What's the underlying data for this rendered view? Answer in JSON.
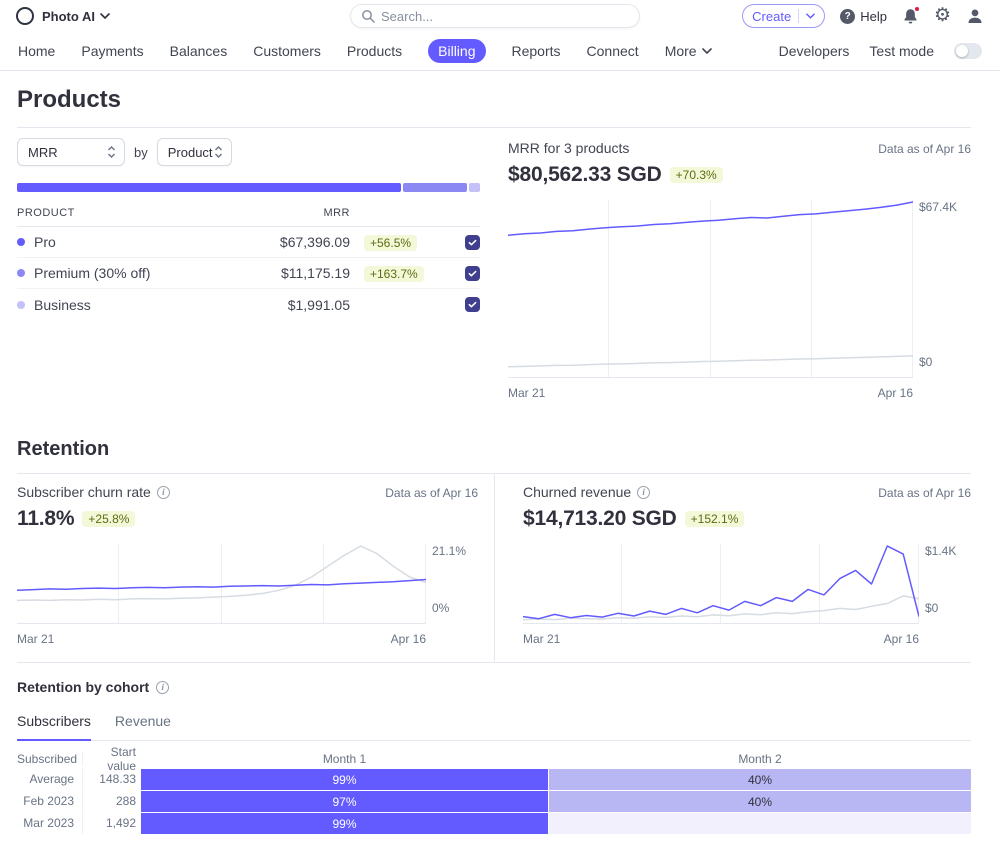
{
  "colors": {
    "accent": "#635bff",
    "hairline": "#e3e8ee",
    "badge_bg": "#f2f8d8",
    "badge_text": "#5f6c12",
    "checkbox": "#3f3e8f",
    "chart_current": "#635bff",
    "chart_previous": "#d7dce2",
    "notification_dot": "#df1b41"
  },
  "header": {
    "app_name": "Photo AI",
    "search_placeholder": "Search...",
    "create_label": "Create",
    "help_label": "Help"
  },
  "nav": {
    "items": [
      "Home",
      "Payments",
      "Balances",
      "Customers",
      "Products",
      "Billing",
      "Reports",
      "Connect",
      "More"
    ],
    "active_item": "Billing",
    "developers_label": "Developers",
    "test_mode_label": "Test mode"
  },
  "page": {
    "title": "Products"
  },
  "mrr_section": {
    "metric_select_value": "MRR",
    "by_label": "by",
    "group_select_value": "Product",
    "table": {
      "col_product": "PRODUCT",
      "col_mrr": "MRR",
      "rows": [
        {
          "name": "Pro",
          "value": "$67,396.09",
          "delta": "+56.5%",
          "color": "#635bff",
          "share_pct": 83.7,
          "checked": true
        },
        {
          "name": "Premium (30% off)",
          "value": "$11,175.19",
          "delta": "+163.7%",
          "color": "#8c88f3",
          "share_pct": 13.9,
          "checked": true
        },
        {
          "name": "Business",
          "value": "$1,991.05",
          "delta": "",
          "color": "#c3c1f7",
          "share_pct": 2.4,
          "checked": true
        }
      ]
    },
    "summary": {
      "title": "MRR for 3 products",
      "data_as_of": "Data as of Apr 16",
      "amount": "$80,562.33 SGD",
      "delta": "+70.3%",
      "y_max_label": "$67.4K",
      "y_min_label": "$0",
      "x_start": "Mar 21",
      "x_end": "Apr 16"
    }
  },
  "retention": {
    "title": "Retention",
    "churn": {
      "title": "Subscriber churn rate",
      "data_as_of": "Data as of Apr 16",
      "value": "11.8%",
      "delta": "+25.8%",
      "y_max_label": "21.1%",
      "y_min_label": "0%",
      "x_start": "Mar 21",
      "x_end": "Apr 16"
    },
    "churned_revenue": {
      "title": "Churned revenue",
      "data_as_of": "Data as of Apr 16",
      "value": "$14,713.20 SGD",
      "delta": "+152.1%",
      "y_max_label": "$1.4K",
      "y_min_label": "$0",
      "x_start": "Mar 21",
      "x_end": "Apr 16"
    },
    "cohort": {
      "title": "Retention by cohort",
      "tabs": [
        "Subscribers",
        "Revenue"
      ],
      "active_tab": "Subscribers",
      "col_subscribed": "Subscribed",
      "col_start_value": "Start value",
      "col_month1": "Month 1",
      "col_month2": "Month 2",
      "rows": [
        {
          "label": "Average",
          "start": "148.33",
          "m1": {
            "text": "99%",
            "bg": "#635bff",
            "fg": "#ffffff"
          },
          "m2": {
            "text": "40%",
            "bg": "#b9b6f4",
            "fg": "#30313d"
          }
        },
        {
          "label": "Feb 2023",
          "start": "288",
          "m1": {
            "text": "97%",
            "bg": "#635bff",
            "fg": "#ffffff"
          },
          "m2": {
            "text": "40%",
            "bg": "#b9b6f4",
            "fg": "#30313d"
          }
        },
        {
          "label": "Mar 2023",
          "start": "1,492",
          "m1": {
            "text": "99%",
            "bg": "#635bff",
            "fg": "#ffffff"
          },
          "m2": {
            "text": "",
            "bg": "#f1f0fc",
            "fg": "#30313d"
          }
        }
      ]
    }
  },
  "chart_data": [
    {
      "id": "mrr_trend",
      "type": "line",
      "title": "MRR for 3 products",
      "x_range": [
        "Mar 21",
        "Apr 16"
      ],
      "y_range": [
        0,
        67400
      ],
      "grid": "vertical",
      "series": [
        {
          "name": "current",
          "color": "#635bff",
          "values": [
            54500,
            55100,
            55400,
            56000,
            56300,
            56900,
            57400,
            57800,
            58100,
            58700,
            59000,
            59500,
            60000,
            60300,
            60900,
            61400,
            61200,
            61900,
            62500,
            62800,
            63400,
            64000,
            64600,
            65300,
            66200,
            67400
          ]
        },
        {
          "name": "previous period",
          "color": "#d7dce2",
          "values": [
            3600,
            3700,
            3900,
            4100,
            4200,
            4400,
            4600,
            4700,
            4900,
            5100,
            5200,
            5400,
            5600,
            5700,
            5900,
            6100,
            6200,
            6400,
            6600,
            6700,
            6900,
            7100,
            7200,
            7400,
            7600,
            7800
          ]
        }
      ]
    },
    {
      "id": "subscriber_churn_rate",
      "type": "line",
      "title": "Subscriber churn rate",
      "x_range": [
        "Mar 21",
        "Apr 16"
      ],
      "y_range": [
        0,
        21.1
      ],
      "grid": "vertical",
      "series": [
        {
          "name": "current",
          "color": "#635bff",
          "values": [
            8.8,
            9.0,
            9.2,
            9.1,
            9.3,
            9.4,
            9.3,
            9.5,
            9.6,
            9.5,
            9.7,
            9.8,
            9.7,
            9.9,
            10.0,
            10.1,
            10.0,
            10.2,
            10.4,
            10.3,
            10.6,
            10.8,
            11.0,
            11.2,
            11.5,
            11.8
          ]
        },
        {
          "name": "previous period",
          "color": "#d7dce2",
          "values": [
            6.0,
            6.1,
            6.0,
            6.2,
            6.1,
            6.3,
            6.2,
            6.4,
            6.5,
            6.4,
            6.6,
            6.7,
            6.9,
            7.1,
            7.4,
            7.9,
            8.8,
            10.2,
            12.5,
            15.5,
            18.5,
            21.1,
            19.0,
            15.5,
            12.5,
            11.0
          ]
        }
      ]
    },
    {
      "id": "churned_revenue",
      "type": "line",
      "title": "Churned revenue",
      "x_range": [
        "Mar 21",
        "Apr 16"
      ],
      "y_range": [
        0,
        1400
      ],
      "grid": "vertical",
      "series": [
        {
          "name": "current",
          "color": "#635bff",
          "values": [
            100,
            60,
            140,
            80,
            120,
            90,
            160,
            110,
            200,
            140,
            250,
            170,
            300,
            220,
            380,
            300,
            450,
            380,
            600,
            500,
            800,
            950,
            700,
            1400,
            1250,
            100
          ]
        },
        {
          "name": "previous period",
          "color": "#d7dce2",
          "values": [
            40,
            55,
            45,
            70,
            60,
            55,
            80,
            70,
            95,
            85,
            110,
            95,
            130,
            115,
            150,
            135,
            170,
            155,
            190,
            210,
            250,
            230,
            290,
            340,
            480,
            430
          ]
        }
      ]
    }
  ]
}
